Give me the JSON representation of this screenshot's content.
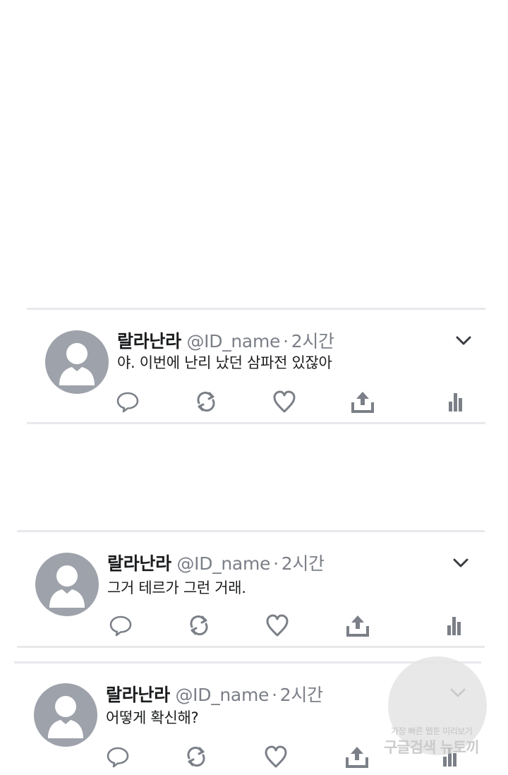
{
  "tweets": [
    {
      "name": "랄라난라",
      "handle": "@ID_name",
      "dot": "·",
      "time": "2시간",
      "text": "야. 이번에 난리 났던 삼파전 있잖아"
    },
    {
      "name": "랄라난라",
      "handle": "@ID_name",
      "dot": "·",
      "time": "2시간",
      "text": "그거 테르가 그런 거래."
    },
    {
      "name": "랄라난라",
      "handle": "@ID_name",
      "dot": "·",
      "time": "2시간",
      "text": "어떻게 확신해?"
    }
  ],
  "icons": {
    "more": "chevron-down-icon",
    "reply": "reply-icon",
    "retweet": "retweet-icon",
    "like": "heart-icon",
    "share": "share-icon",
    "stats": "stats-icon"
  },
  "colors": {
    "icon": "#7b7f87",
    "avatar": "#9ea2ab",
    "divider": "#e8e9ec",
    "text": "#1b1c1e"
  },
  "watermark": {
    "line1": "가장 빠른 웹툰 미리보기",
    "line2": "구글검색 뉴토끼"
  }
}
